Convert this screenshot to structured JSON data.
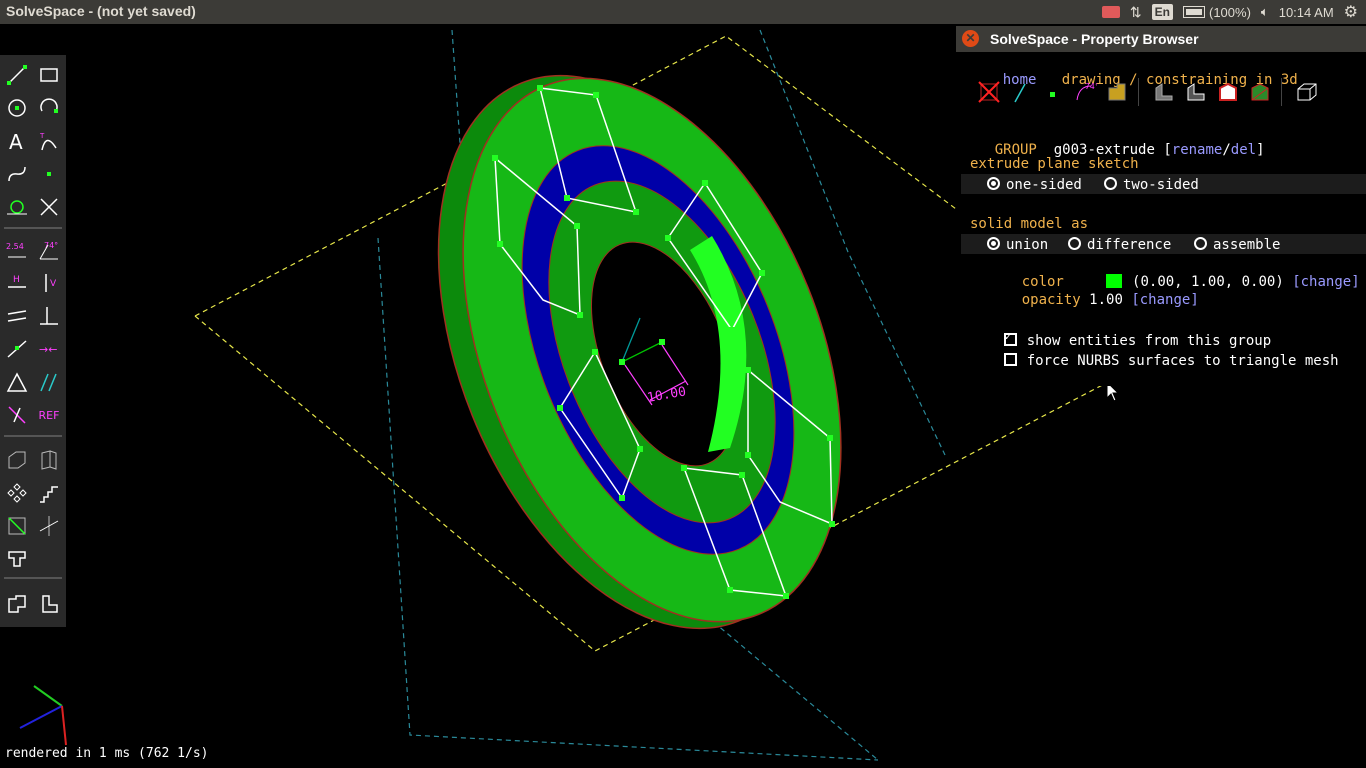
{
  "window": {
    "title": "SolveSpace - (not yet saved)"
  },
  "tray": {
    "lang": "En",
    "battery": "(100%)",
    "time": "10:14 AM"
  },
  "status": "rendered in 1 ms (762 1/s)",
  "canvas": {
    "dimension_label": "10.00",
    "colors": {
      "solid": "#16b816",
      "bright": "#22ff22",
      "hole": "#0000aa",
      "edge": "#a03020",
      "sketch": "#ffffff",
      "dimension": "#ff40ff"
    }
  },
  "toolbar": {
    "ref_label": "REF",
    "dim_label": "2.54",
    "angle_label": "74°",
    "h_label": "H",
    "v_label": "V"
  },
  "property_browser": {
    "title": "SolveSpace - Property Browser",
    "nav": {
      "home": "home",
      "breadcrumb": "drawing / constraining in 3d"
    },
    "group_label": "GROUP",
    "group_name": "g003-extrude",
    "rename": "rename",
    "slash": "/",
    "del": "del",
    "bracket_open": "[",
    "bracket_close": "]",
    "extrude_heading": "extrude plane sketch",
    "one_sided": "one-sided",
    "two_sided": "two-sided",
    "solid_heading": "solid model as",
    "union": "union",
    "difference": "difference",
    "assemble": "assemble",
    "color_label": "color",
    "color_value": "(0.00, 1.00, 0.00)",
    "change": "[change]",
    "opacity_label": "opacity",
    "opacity_value": "1.00",
    "show_entities": "show entities from this group",
    "force_nurbs": "force NURBS surfaces to triangle mesh"
  }
}
